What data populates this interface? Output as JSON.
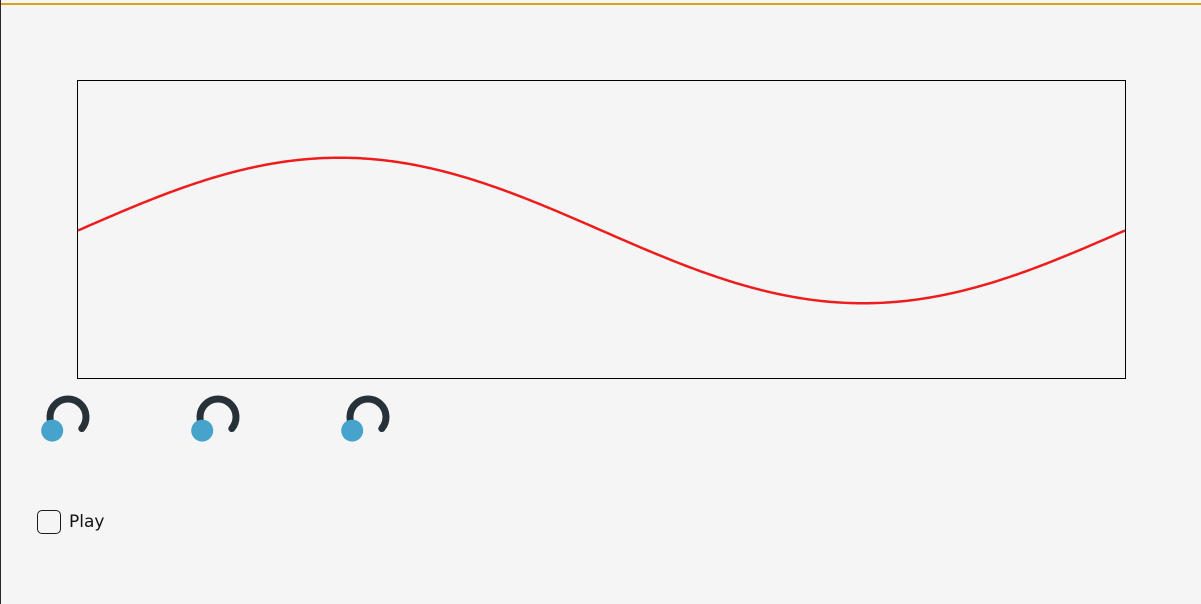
{
  "colors": {
    "background": "#f5f5f5",
    "top_accent": "#d9a21b",
    "wave": "#ee1c1c",
    "knob_ring": "#263238",
    "knob_indicator": "#46a3cc"
  },
  "wave": {
    "cycles": 1,
    "amplitude_fraction": 0.49
  },
  "knobs": [
    {
      "name": "knob-1",
      "value": 0.0
    },
    {
      "name": "knob-2",
      "value": 0.0
    },
    {
      "name": "knob-3",
      "value": 0.0
    }
  ],
  "play": {
    "label": "Play",
    "checked": false
  }
}
